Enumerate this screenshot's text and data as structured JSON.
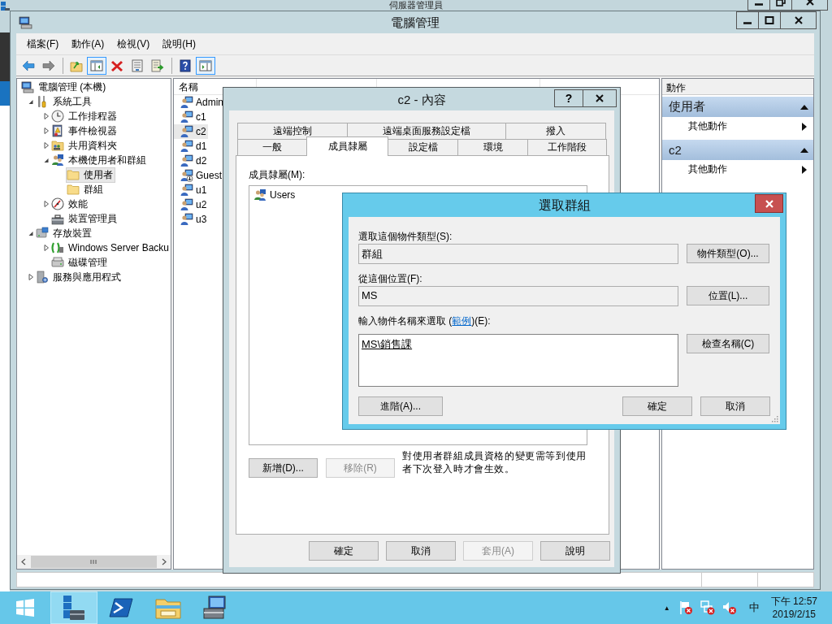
{
  "background_window": {
    "title": "伺服器管理員"
  },
  "main_window": {
    "title": "電腦管理",
    "menu": [
      {
        "label": "檔案(F)"
      },
      {
        "label": "動作(A)"
      },
      {
        "label": "檢視(V)"
      },
      {
        "label": "說明(H)"
      }
    ],
    "toolbar": [
      [
        {
          "kind": "back",
          "selected": false
        },
        {
          "kind": "forward",
          "selected": false
        }
      ],
      [
        {
          "kind": "up",
          "selected": false
        },
        {
          "kind": "tree",
          "selected": true
        },
        {
          "kind": "delete",
          "selected": false
        },
        {
          "kind": "properties",
          "selected": false
        },
        {
          "kind": "export",
          "selected": false
        }
      ],
      [
        {
          "kind": "help",
          "selected": false
        },
        {
          "kind": "pane",
          "selected": true
        }
      ]
    ],
    "tree": [
      {
        "label": "電腦管理 (本機)",
        "kind": "computer",
        "selected": false,
        "children": [
          {
            "label": "系統工具",
            "kind": "tools",
            "selected": false,
            "expanded": true,
            "children": [
              {
                "label": "工作排程器",
                "kind": "clock",
                "selected": false,
                "expanded": false
              },
              {
                "label": "事件檢視器",
                "kind": "event",
                "selected": false,
                "expanded": false
              },
              {
                "label": "共用資料夾",
                "kind": "share",
                "selected": false,
                "expanded": false
              },
              {
                "label": "本機使用者和群組",
                "kind": "users",
                "selected": false,
                "expanded": true,
                "children": [
                  {
                    "label": "使用者",
                    "kind": "folder",
                    "selected": true
                  },
                  {
                    "label": "群組",
                    "kind": "folder",
                    "selected": false
                  }
                ]
              },
              {
                "label": "效能",
                "kind": "perf",
                "selected": false,
                "expanded": false
              },
              {
                "label": "裝置管理員",
                "kind": "device",
                "selected": false
              }
            ]
          },
          {
            "label": "存放裝置",
            "kind": "storage",
            "selected": false,
            "expanded": true,
            "children": [
              {
                "label": "Windows Server Backu",
                "kind": "backup",
                "selected": false,
                "expanded": false
              },
              {
                "label": "磁碟管理",
                "kind": "disk",
                "selected": false
              }
            ]
          },
          {
            "label": "服務與應用程式",
            "kind": "services",
            "selected": false,
            "expanded": false
          }
        ]
      }
    ],
    "list": {
      "columns": [
        "名稱"
      ],
      "rows": [
        {
          "name": "Admin",
          "kind": "user",
          "selected": false
        },
        {
          "name": "c1",
          "kind": "user",
          "selected": false
        },
        {
          "name": "c2",
          "kind": "user",
          "selected": true
        },
        {
          "name": "d1",
          "kind": "user",
          "selected": false
        },
        {
          "name": "d2",
          "kind": "user",
          "selected": false
        },
        {
          "name": "Guest",
          "kind": "user-disabled",
          "selected": false
        },
        {
          "name": "u1",
          "kind": "user",
          "selected": false
        },
        {
          "name": "u2",
          "kind": "user",
          "selected": false
        },
        {
          "name": "u3",
          "kind": "user",
          "selected": false
        }
      ]
    },
    "actions": {
      "title": "動作",
      "sections": [
        {
          "title": "使用者",
          "expanded": true,
          "items": [
            "其他動作"
          ]
        },
        {
          "title": "c2",
          "expanded": true,
          "items": [
            "其他動作"
          ]
        }
      ]
    }
  },
  "properties_dialog": {
    "title": "c2 - 內容",
    "help_button": "?",
    "tab_rows": [
      [
        {
          "label": "遠端控制",
          "selected": false
        },
        {
          "label": "遠端桌面服務設定檔",
          "selected": false
        },
        {
          "label": "撥入",
          "selected": false
        }
      ],
      [
        {
          "label": "一般",
          "selected": false
        },
        {
          "label": "成員隸屬",
          "selected": true
        },
        {
          "label": "設定檔",
          "selected": false
        },
        {
          "label": "環境",
          "selected": false
        },
        {
          "label": "工作階段",
          "selected": false
        }
      ]
    ],
    "members_label": "成員隸屬(M):",
    "members": [
      {
        "name": "Users",
        "selected": false
      }
    ],
    "buttons": [
      {
        "label": "新增(D)...",
        "disabled": false
      },
      {
        "label": "移除(R)",
        "disabled": true
      }
    ],
    "note": "對使用者群組成員資格的變更需等到使用者下次登入時才會生效。",
    "footer_buttons": [
      {
        "label": "確定",
        "disabled": false
      },
      {
        "label": "取消",
        "disabled": false
      },
      {
        "label": "套用(A)",
        "disabled": true
      },
      {
        "label": "說明",
        "disabled": false
      }
    ]
  },
  "select_dialog": {
    "title": "選取群組",
    "object_type": {
      "label": "選取這個物件類型(S):",
      "value": "群組",
      "button": "物件類型(O)..."
    },
    "location": {
      "label": "從這個位置(F):",
      "value": "MS",
      "button": "位置(L)..."
    },
    "names": {
      "label_before": "輸入物件名稱來選取 (",
      "link": "範例",
      "label_after": ")(E):",
      "value": "MS\\銷售課",
      "button": "檢查名稱(C)"
    },
    "footer_buttons": [
      {
        "label": "進階(A)..."
      },
      {
        "label": "確定"
      },
      {
        "label": "取消"
      }
    ]
  },
  "taskbar": {
    "apps": [
      {
        "kind": "server-manager",
        "selected": true
      },
      {
        "kind": "powershell",
        "selected": false
      },
      {
        "kind": "explorer",
        "selected": false
      },
      {
        "kind": "computer-management",
        "selected": false
      }
    ],
    "tray": {
      "overflow": "▲",
      "ime": "中",
      "time": "下午 12:57",
      "date": "2019/2/15"
    }
  }
}
